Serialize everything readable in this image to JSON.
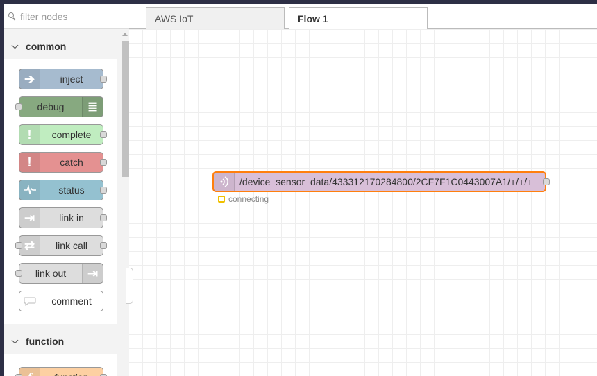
{
  "palette": {
    "filter": {
      "placeholder": "filter nodes"
    },
    "categories": [
      {
        "label": "common",
        "nodes": [
          {
            "label": "inject",
            "color": "#a6bbcf",
            "icon": "arrow-in-icon",
            "glyph": "➔",
            "ports": "out"
          },
          {
            "label": "debug",
            "color": "#87a980",
            "icon": "list-icon",
            "glyph": "≣",
            "ports": "in"
          },
          {
            "label": "complete",
            "color": "#c0edc0",
            "icon": "exclamation-icon",
            "glyph": "!",
            "ports": "out"
          },
          {
            "label": "catch",
            "color": "#e49191",
            "icon": "exclamation-icon",
            "glyph": "!",
            "ports": "out"
          },
          {
            "label": "status",
            "color": "#94c1d0",
            "icon": "pulse-icon",
            "glyph": "∿",
            "ports": "out"
          },
          {
            "label": "link in",
            "color": "#dddddd",
            "icon": "link-in-icon",
            "glyph": "⇥",
            "ports": "out"
          },
          {
            "label": "link call",
            "color": "#dddddd",
            "icon": "link-call-icon",
            "glyph": "⇄",
            "ports": "both"
          },
          {
            "label": "link out",
            "color": "#dddddd",
            "icon": "link-out-icon",
            "glyph": "⇥",
            "ports": "in"
          },
          {
            "label": "comment",
            "color": "#ffffff",
            "icon": "comment-icon",
            "glyph": "💬",
            "ports": "none"
          }
        ]
      },
      {
        "label": "function",
        "nodes": [
          {
            "label": "function",
            "color": "#fdd0a2",
            "icon": "function-icon",
            "glyph": "f",
            "ports": "both"
          }
        ]
      }
    ]
  },
  "tabs": [
    {
      "label": "AWS IoT",
      "active": false
    },
    {
      "label": "Flow 1",
      "active": true
    }
  ],
  "flow": {
    "node": {
      "label": "/device_sensor_data/433312170284800/2CF7F1C0443007A1/+/+/+",
      "color": "#d8bfd8",
      "selected_border": "#ff7f0e",
      "icon": "mqtt-in-icon"
    },
    "status": {
      "text": "connecting",
      "color": "#f0c000"
    }
  }
}
